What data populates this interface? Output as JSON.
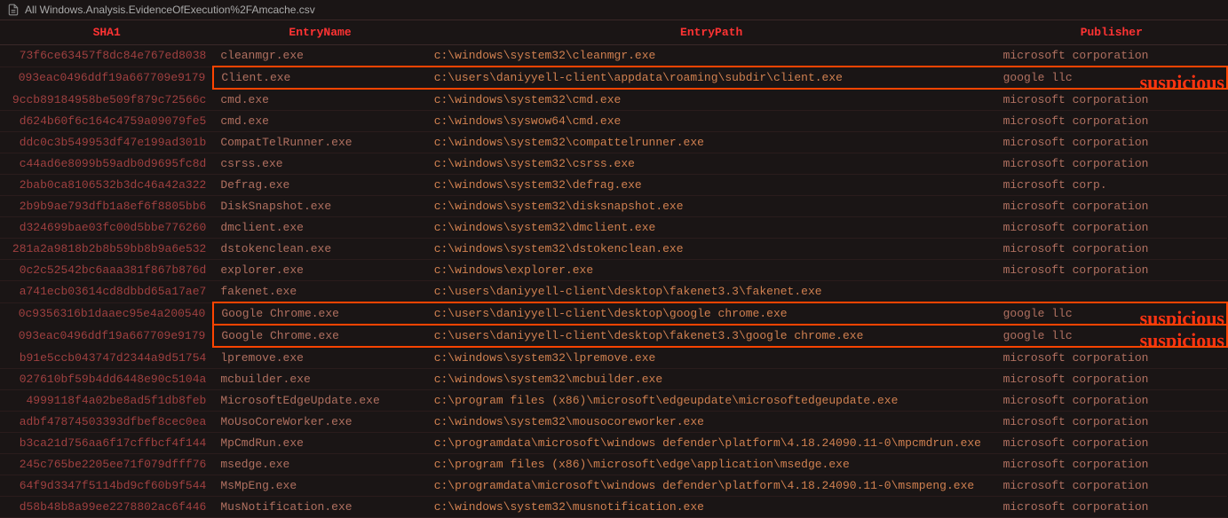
{
  "tab": {
    "title": "All Windows.Analysis.EvidenceOfExecution%2FAmcache.csv"
  },
  "headers": {
    "sha1": "SHA1",
    "entryname": "EntryName",
    "entrypath": "EntryPath",
    "publisher": "Publisher"
  },
  "suspicious_label": "suspicious",
  "rows": [
    {
      "sha1": "73f6ce63457f8dc84e767ed8038",
      "entryname": "cleanmgr.exe",
      "entrypath": "c:\\windows\\system32\\cleanmgr.exe",
      "publisher": "microsoft corporation",
      "highlight": false
    },
    {
      "sha1": "093eac0496ddf19a667709e9179",
      "entryname": "Client.exe",
      "entrypath": "c:\\users\\daniyyell-client\\appdata\\roaming\\subdir\\client.exe",
      "publisher": "google llc",
      "highlight": true
    },
    {
      "sha1": "9ccb89184958be509f879c72566c",
      "entryname": "cmd.exe",
      "entrypath": "c:\\windows\\system32\\cmd.exe",
      "publisher": "microsoft corporation",
      "highlight": false
    },
    {
      "sha1": "d624b60f6c164c4759a09079fe5",
      "entryname": "cmd.exe",
      "entrypath": "c:\\windows\\syswow64\\cmd.exe",
      "publisher": "microsoft corporation",
      "highlight": false
    },
    {
      "sha1": "ddc0c3b549953df47e199ad301b",
      "entryname": "CompatTelRunner.exe",
      "entrypath": "c:\\windows\\system32\\compattelrunner.exe",
      "publisher": "microsoft corporation",
      "highlight": false
    },
    {
      "sha1": "c44ad6e8099b59adb0d9695fc8d",
      "entryname": "csrss.exe",
      "entrypath": "c:\\windows\\system32\\csrss.exe",
      "publisher": "microsoft corporation",
      "highlight": false
    },
    {
      "sha1": "2bab0ca8106532b3dc46a42a322",
      "entryname": "Defrag.exe",
      "entrypath": "c:\\windows\\system32\\defrag.exe",
      "publisher": "microsoft corp.",
      "highlight": false
    },
    {
      "sha1": "2b9b9ae793dfb1a8ef6f8805bb6",
      "entryname": "DiskSnapshot.exe",
      "entrypath": "c:\\windows\\system32\\disksnapshot.exe",
      "publisher": "microsoft corporation",
      "highlight": false
    },
    {
      "sha1": "d324699bae03fc00d5bbe776260",
      "entryname": "dmclient.exe",
      "entrypath": "c:\\windows\\system32\\dmclient.exe",
      "publisher": "microsoft corporation",
      "highlight": false
    },
    {
      "sha1": "281a2a9818b2b8b59bb8b9a6e532",
      "entryname": "dstokenclean.exe",
      "entrypath": "c:\\windows\\system32\\dstokenclean.exe",
      "publisher": "microsoft corporation",
      "highlight": false
    },
    {
      "sha1": "0c2c52542bc6aaa381f867b876d",
      "entryname": "explorer.exe",
      "entrypath": "c:\\windows\\explorer.exe",
      "publisher": "microsoft corporation",
      "highlight": false
    },
    {
      "sha1": "a741ecb03614cd8dbbd65a17ae7",
      "entryname": "fakenet.exe",
      "entrypath": "c:\\users\\daniyyell-client\\desktop\\fakenet3.3\\fakenet.exe",
      "publisher": "",
      "highlight": false
    },
    {
      "sha1": "0c9356316b1daaec95e4a200540",
      "entryname": "Google Chrome.exe",
      "entrypath": "c:\\users\\daniyyell-client\\desktop\\google chrome.exe",
      "publisher": "google llc",
      "highlight": true
    },
    {
      "sha1": "093eac0496ddf19a667709e9179",
      "entryname": "Google Chrome.exe",
      "entrypath": "c:\\users\\daniyyell-client\\desktop\\fakenet3.3\\google chrome.exe",
      "publisher": "google llc",
      "highlight": true
    },
    {
      "sha1": "b91e5ccb043747d2344a9d51754",
      "entryname": "lpremove.exe",
      "entrypath": "c:\\windows\\system32\\lpremove.exe",
      "publisher": "microsoft corporation",
      "highlight": false
    },
    {
      "sha1": "027610bf59b4dd6448e90c5104a",
      "entryname": "mcbuilder.exe",
      "entrypath": "c:\\windows\\system32\\mcbuilder.exe",
      "publisher": "microsoft corporation",
      "highlight": false
    },
    {
      "sha1": "4999118f4a02be8ad5f1db8feb",
      "entryname": "MicrosoftEdgeUpdate.exe",
      "entrypath": "c:\\program files (x86)\\microsoft\\edgeupdate\\microsoftedgeupdate.exe",
      "publisher": "microsoft corporation",
      "highlight": false
    },
    {
      "sha1": "adbf47874503393dfbef8cec0ea",
      "entryname": "MoUsoCoreWorker.exe",
      "entrypath": "c:\\windows\\system32\\mousocoreworker.exe",
      "publisher": "microsoft corporation",
      "highlight": false
    },
    {
      "sha1": "b3ca21d756aa6f17cffbcf4f144",
      "entryname": "MpCmdRun.exe",
      "entrypath": "c:\\programdata\\microsoft\\windows defender\\platform\\4.18.24090.11-0\\mpcmdrun.exe",
      "publisher": "microsoft corporation",
      "highlight": false
    },
    {
      "sha1": "245c765be2205ee71f079dfff76",
      "entryname": "msedge.exe",
      "entrypath": "c:\\program files (x86)\\microsoft\\edge\\application\\msedge.exe",
      "publisher": "microsoft corporation",
      "highlight": false
    },
    {
      "sha1": "64f9d3347f5114bd9cf60b9f544",
      "entryname": "MsMpEng.exe",
      "entrypath": "c:\\programdata\\microsoft\\windows defender\\platform\\4.18.24090.11-0\\msmpeng.exe",
      "publisher": "microsoft corporation",
      "highlight": false
    },
    {
      "sha1": "d58b48b8a99ee2278802ac6f446",
      "entryname": "MusNotification.exe",
      "entrypath": "c:\\windows\\system32\\musnotification.exe",
      "publisher": "microsoft corporation",
      "highlight": false
    }
  ]
}
